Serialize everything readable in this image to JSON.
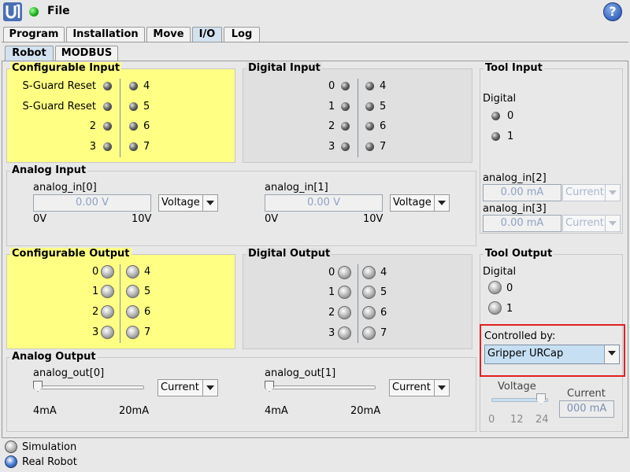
{
  "app": {
    "menu_label": "File"
  },
  "help_label": "?",
  "tabs": [
    "Program",
    "Installation",
    "Move",
    "I/O",
    "Log"
  ],
  "subtabs": [
    "Robot",
    "MODBUS"
  ],
  "configurable_input": {
    "title": "Configurable Input",
    "left": [
      "S-Guard Reset",
      "S-Guard Reset",
      "2",
      "3"
    ],
    "right": [
      "4",
      "5",
      "6",
      "7"
    ]
  },
  "digital_input": {
    "title": "Digital Input",
    "left": [
      "0",
      "1",
      "2",
      "3"
    ],
    "right": [
      "4",
      "5",
      "6",
      "7"
    ]
  },
  "tool_input": {
    "title": "Tool Input",
    "digital_label": "Digital",
    "digital": [
      "0",
      "1"
    ],
    "analog": [
      {
        "label": "analog_in[2]",
        "value": "0.00 mA",
        "mode": "Current"
      },
      {
        "label": "analog_in[3]",
        "value": "0.00 mA",
        "mode": "Current"
      }
    ]
  },
  "analog_input": {
    "title": "Analog Input",
    "channels": [
      {
        "label": "analog_in[0]",
        "value": "0.00 V",
        "mode": "Voltage",
        "min": "0V",
        "max": "10V"
      },
      {
        "label": "analog_in[1]",
        "value": "0.00 V",
        "mode": "Voltage",
        "min": "0V",
        "max": "10V"
      }
    ]
  },
  "configurable_output": {
    "title": "Configurable Output",
    "left": [
      "0",
      "1",
      "2",
      "3"
    ],
    "right": [
      "4",
      "5",
      "6",
      "7"
    ]
  },
  "digital_output": {
    "title": "Digital Output",
    "left": [
      "0",
      "1",
      "2",
      "3"
    ],
    "right": [
      "4",
      "5",
      "6",
      "7"
    ]
  },
  "tool_output": {
    "title": "Tool Output",
    "digital_label": "Digital",
    "digital": [
      "0",
      "1"
    ],
    "controlled_by_label": "Controlled by:",
    "controlled_by_value": "Gripper URCap",
    "voltage_label": "Voltage",
    "voltage_ticks": [
      "0",
      "12",
      "24"
    ],
    "voltage_level": 24,
    "current_label": "Current",
    "current_value": "000 mA"
  },
  "analog_output": {
    "title": "Analog Output",
    "channels": [
      {
        "label": "analog_out[0]",
        "mode": "Current",
        "min": "4mA",
        "max": "20mA",
        "level": 4
      },
      {
        "label": "analog_out[1]",
        "mode": "Current",
        "min": "4mA",
        "max": "20mA",
        "level": 4
      }
    ]
  },
  "legend": [
    "Simulation",
    "Real Robot"
  ],
  "colors": {
    "tab_active": "#d3e2ef",
    "configurable_bg": "#ffff84",
    "highlight_border": "#e02020",
    "combo_selected": "#c6dff3"
  }
}
